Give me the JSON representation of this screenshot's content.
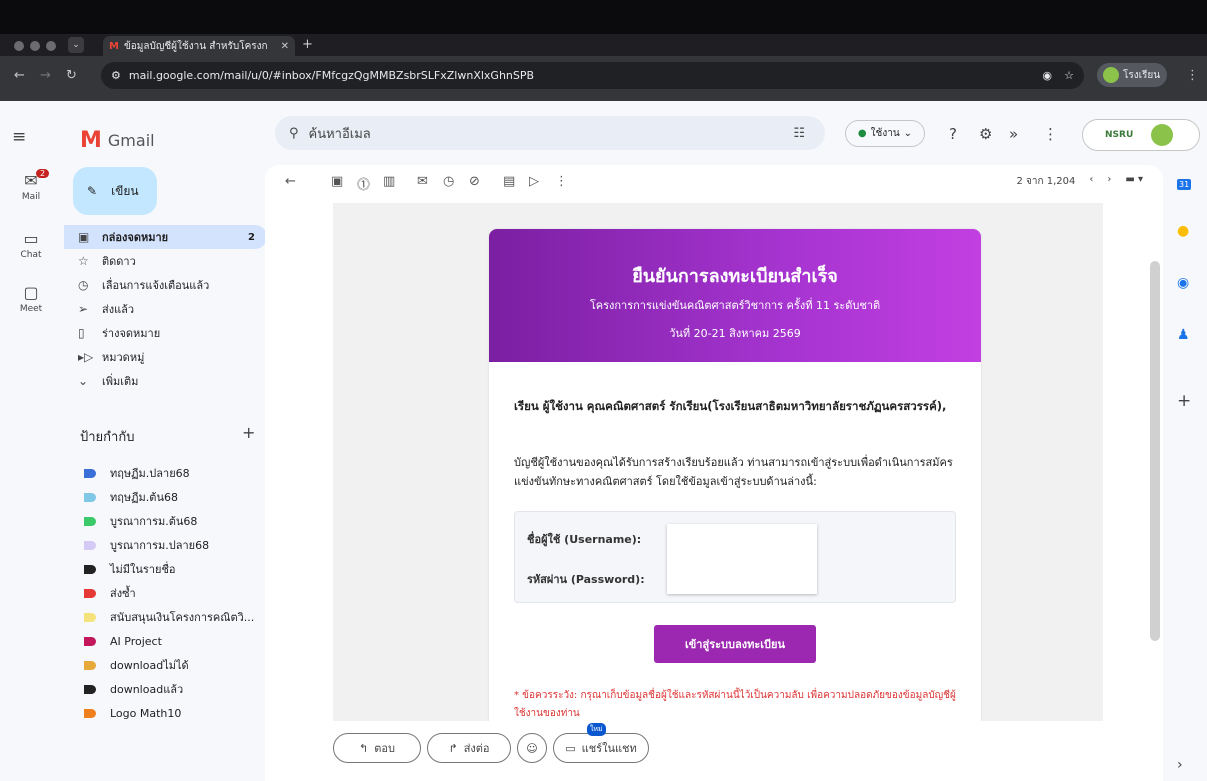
{
  "browser": {
    "tab_title": "ข้อมูลบัญชีผู้ใช้งาน สำหรับโครงก",
    "new_tab": "+",
    "url": "mail.google.com/mail/u/0/#inbox/FMfcgzQgMMBZsbrSLFxZlwnXlxGhnSPB",
    "profile_name": "โรงเรียน"
  },
  "gmail": {
    "app_name": "Gmail",
    "search_placeholder": "ค้นหาอีเมล",
    "status": "ใช้งาน",
    "rail": [
      {
        "label": "Mail",
        "badge": "2"
      },
      {
        "label": "Chat"
      },
      {
        "label": "Meet"
      }
    ],
    "compose": "เขียน",
    "nav": [
      {
        "label": "กล่องจดหมาย",
        "count": "2"
      },
      {
        "label": "ติดดาว"
      },
      {
        "label": "เลื่อนการแจ้งเตือนแล้ว"
      },
      {
        "label": "ส่งแล้ว"
      },
      {
        "label": "ร่างจดหมาย"
      },
      {
        "label": "หมวดหมู่"
      },
      {
        "label": "เพิ่มเติม"
      }
    ],
    "labels_title": "ป้ายกำกับ",
    "labels_add": "+",
    "labels": [
      {
        "name": "ทฤษฏีม.ปลาย68",
        "color": "#3b6fd8"
      },
      {
        "name": "ทฤษฏีม.ต้น68",
        "color": "#7fc8e8"
      },
      {
        "name": "บูรณาการม.ต้น68",
        "color": "#3cc96a"
      },
      {
        "name": "บูรณาการม.ปลาย68",
        "color": "#d5c9f5"
      },
      {
        "name": "ไม่มีในรายชื่อ",
        "color": "#222222"
      },
      {
        "name": "ส่งซ้ำ",
        "color": "#e53935"
      },
      {
        "name": "สนับสนุนเงินโครงการคณิตวิ...",
        "color": "#f5e27a"
      },
      {
        "name": "AI Project",
        "color": "#c2185b"
      },
      {
        "name": "downloadไม่ได้",
        "color": "#e6a93a"
      },
      {
        "name": "downloadแล้ว",
        "color": "#222222"
      },
      {
        "name": "Logo Math10",
        "color": "#f07f1e"
      }
    ],
    "pager": {
      "text": "2 จาก 1,204"
    },
    "account_text": "NSRU"
  },
  "email": {
    "hero_title": "ยืนยันการลงทะเบียนสำเร็จ",
    "hero_subtitle": "โครงการการแข่งขันคณิตศาสตร์วิชาการ ครั้งที่ 11 ระดับชาติ",
    "hero_date": "วันที่ 20-21 สิงหาคม 2569",
    "greeting": "เรียน ผู้ใช้งาน คุณคณิตศาสตร์ รักเรียน(โรงเรียนสาธิตมหาวิทยาลัยราชภัฏนครสวรรค์),",
    "body": "บัญชีผู้ใช้งานของคุณได้รับการสร้างเรียบร้อยแล้ว ท่านสามารถเข้าสู่ระบบเพื่อดำเนินการสมัครแข่งขันทักษะทางคณิตศาสตร์ โดยใช้ข้อมูลเข้าสู่ระบบด้านล่างนี้:",
    "username_label": "ชื่อผู้ใช้ (Username):",
    "password_label": "รหัสผ่าน (Password):",
    "login_button": "เข้าสู่ระบบลงทะเบียน",
    "warning": "* ข้อควรระวัง: กรุณาเก็บข้อมูลชื่อผู้ใช้และรหัสผ่านนี้ไว้เป็นความลับ เพื่อความปลอดภัยของข้อมูลบัญชีผู้ใช้งานของท่าน"
  },
  "reply": {
    "reply": "ตอบ",
    "forward": "ส่งต่อ",
    "share_chat": "แชร์ในแชท",
    "new_badge": "ใหม่"
  }
}
